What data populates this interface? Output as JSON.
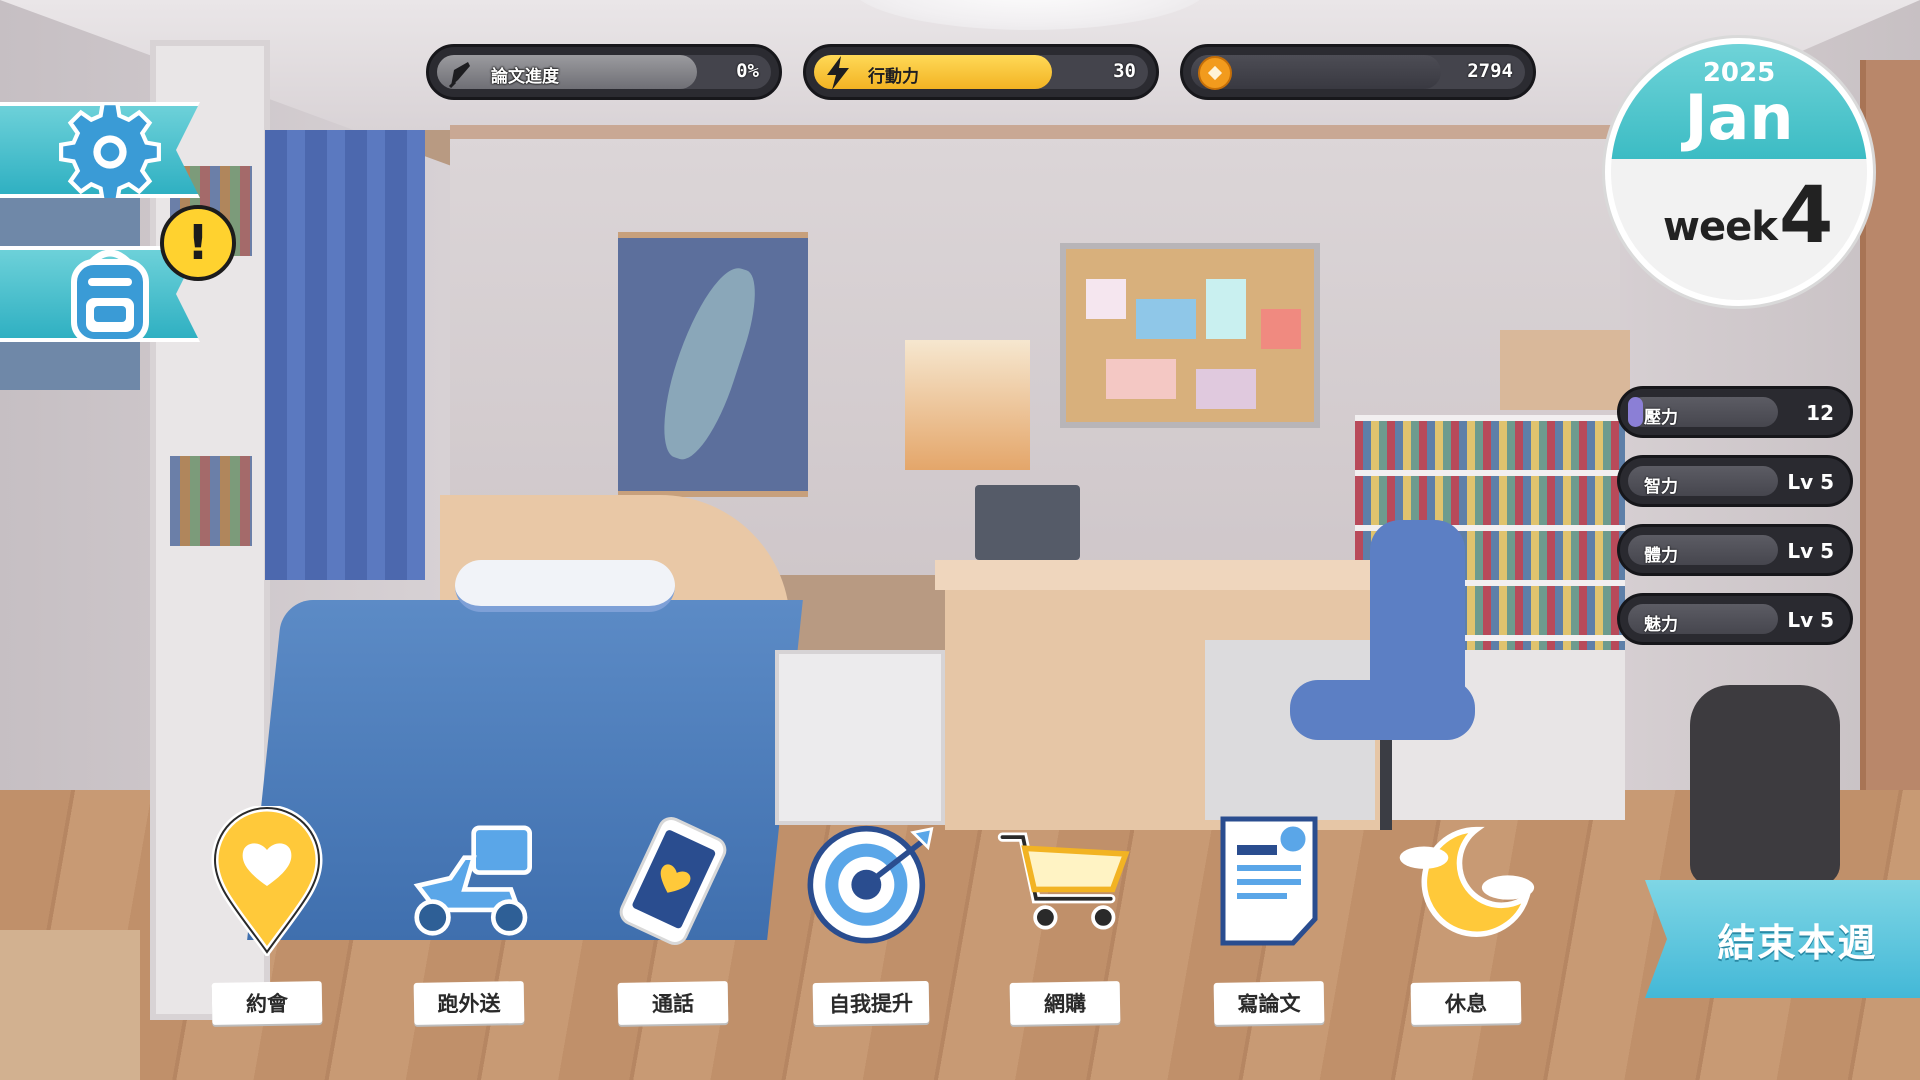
{
  "hud": {
    "thesis": {
      "label": "論文進度",
      "value": "0%",
      "icon": "quill-pen-icon",
      "fill": 0
    },
    "energy": {
      "label": "行動力",
      "value": "30",
      "icon": "lightning-icon",
      "fill": 0.7,
      "color": "#f7c531"
    },
    "coins": {
      "value": "2794",
      "icon": "coin-icon",
      "color": "#f29b1d"
    }
  },
  "calendar": {
    "year": "2025",
    "month": "Jan",
    "week_label": "week",
    "week_number": "4"
  },
  "side_menu": {
    "settings_icon": "gear-icon",
    "inventory_icon": "backpack-icon",
    "alert": "!"
  },
  "stats": [
    {
      "label": "壓力",
      "value": "12",
      "fill": 0.1
    },
    {
      "label": "智力",
      "value": "Lv 5"
    },
    {
      "label": "體力",
      "value": "Lv 5"
    },
    {
      "label": "魅力",
      "value": "Lv 5"
    }
  ],
  "actions": [
    {
      "label": "約會",
      "icon": "heart-pin-icon"
    },
    {
      "label": "跑外送",
      "icon": "delivery-scooter-icon"
    },
    {
      "label": "通話",
      "icon": "phone-icon"
    },
    {
      "label": "自我提升",
      "icon": "target-icon"
    },
    {
      "label": "網購",
      "icon": "shopping-cart-icon"
    },
    {
      "label": "寫論文",
      "icon": "document-icon"
    },
    {
      "label": "休息",
      "icon": "moon-icon"
    }
  ],
  "end_week": {
    "label": "結束本週"
  },
  "colors": {
    "accent": "#43b8d7",
    "energy": "#f7c531",
    "stress": "#8b7fd6"
  }
}
